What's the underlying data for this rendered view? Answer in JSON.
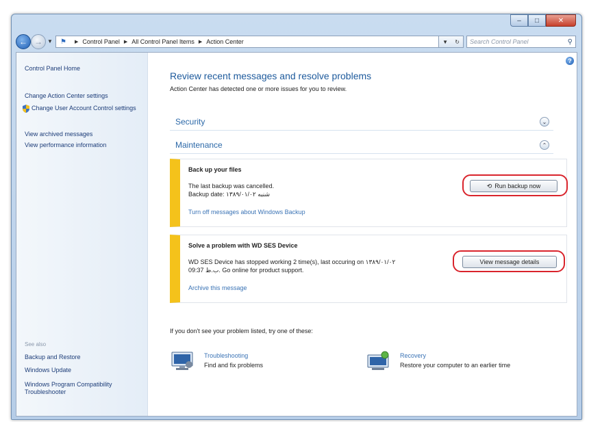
{
  "window": {
    "caption": {
      "minimize": "–",
      "maximize": "□",
      "close": "✕"
    }
  },
  "navbar": {
    "breadcrumbs": [
      "Control Panel",
      "All Control Panel Items",
      "Action Center"
    ],
    "search_placeholder": "Search Control Panel"
  },
  "sidebar": {
    "home": "Control Panel Home",
    "links": [
      "Change Action Center settings",
      "Change User Account Control settings",
      "View archived messages",
      "View performance information"
    ],
    "see_also_label": "See also",
    "see_also": [
      "Backup and Restore",
      "Windows Update",
      "Windows Program Compatibility Troubleshooter"
    ]
  },
  "main": {
    "title": "Review recent messages and resolve problems",
    "subtitle": "Action Center has detected one or more issues for you to review.",
    "sections": [
      {
        "label": "Security"
      },
      {
        "label": "Maintenance"
      }
    ],
    "messages": [
      {
        "title": "Back up your files",
        "line1": "The last backup was cancelled.",
        "line2": "Backup date: شنبه ۱۳۸۹/۰۱/۰۲",
        "link": "Turn off messages about Windows Backup",
        "button": "Run backup now"
      },
      {
        "title": "Solve a problem with WD SES Device",
        "line1": "WD SES Device has stopped working 2 time(s), last occuring on ۱۳۸۹/۰۱/۰۲",
        "line2": "09:37 ب.ظ. Go online for product support.",
        "link": "Archive this message",
        "button": "View message details"
      }
    ],
    "trouble_text": "If you don't see your problem listed, try one of these:",
    "tools": [
      {
        "title": "Troubleshooting",
        "desc": "Find and fix problems"
      },
      {
        "title": "Recovery",
        "desc": "Restore your computer to an earlier time"
      }
    ]
  },
  "colors": {
    "accent": "#1d5a9c",
    "warning_stripe": "#f4c21b",
    "highlight_ring": "#d9232b"
  }
}
